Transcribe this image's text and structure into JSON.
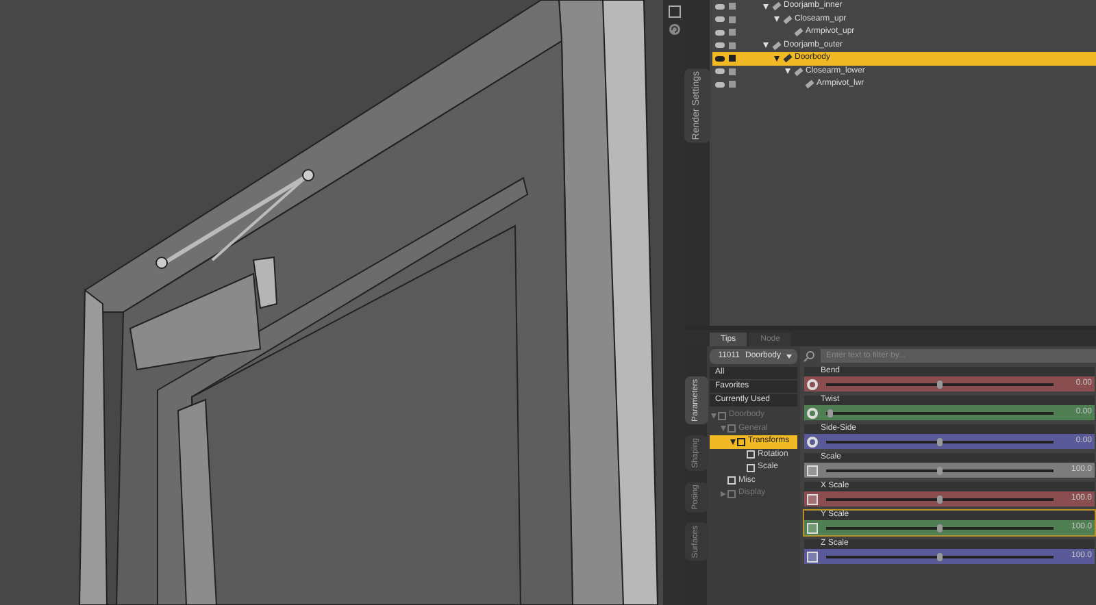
{
  "scene_tree": {
    "tab": "Render Settings",
    "nodes": [
      {
        "label": "Doorjamb_inner",
        "selected": false,
        "expanded": true,
        "children": [
          {
            "label": "Closearm_upr",
            "selected": false,
            "expanded": true,
            "children": [
              {
                "label": "Armpivot_upr",
                "selected": false
              }
            ]
          }
        ]
      },
      {
        "label": "Doorjamb_outer",
        "selected": false,
        "expanded": true,
        "children": [
          {
            "label": "Doorbody",
            "selected": true,
            "expanded": true,
            "children": [
              {
                "label": "Closearm_lower",
                "selected": false,
                "expanded": true,
                "children": [
                  {
                    "label": "Armpivot_lwr",
                    "selected": false
                  }
                ]
              }
            ]
          }
        ]
      }
    ]
  },
  "pane_tabs": [
    {
      "label": "Tips",
      "selected": true
    },
    {
      "label": "Node",
      "selected": false
    }
  ],
  "side_tabs": [
    {
      "label": "Parameters",
      "selected": true
    },
    {
      "label": "Shaping",
      "selected": false
    },
    {
      "label": "Posing",
      "selected": false
    },
    {
      "label": "Surfaces",
      "selected": false
    }
  ],
  "parameters": {
    "node_menu": {
      "prefix": "11011",
      "label": "Doorbody"
    },
    "search": {
      "placeholder": "Enter text to filter by..."
    },
    "categories": [
      {
        "label": "All"
      },
      {
        "label": "Favorites"
      },
      {
        "label": "Currently Used"
      }
    ],
    "groups": [
      {
        "label": "Doorbody",
        "selected": false,
        "disabled": true,
        "expanded": true,
        "children": [
          {
            "label": "General",
            "selected": false,
            "disabled": true,
            "expanded": true,
            "children": [
              {
                "label": "Transforms",
                "selected": true,
                "disabled": false,
                "expanded": true,
                "children": [
                  {
                    "label": "Rotation",
                    "selected": false,
                    "disabled": false
                  },
                  {
                    "label": "Scale",
                    "selected": false,
                    "disabled": false
                  }
                ]
              }
            ]
          },
          {
            "label": "Misc",
            "selected": false,
            "disabled": false
          },
          {
            "label": "Display",
            "selected": false,
            "disabled": true,
            "expanded": false
          }
        ]
      }
    ],
    "sliders": [
      {
        "label": "Bend",
        "kind": "rotate",
        "color": "#8a4e50",
        "level": 0.5,
        "reading": "0.00",
        "selected": false
      },
      {
        "label": "Twist",
        "kind": "rotate",
        "color": "#4f7f52",
        "level": 0.02,
        "reading": "0.00",
        "selected": false
      },
      {
        "label": "Side-Side",
        "kind": "rotate",
        "color": "#5a5a98",
        "level": 0.5,
        "reading": "0.00",
        "selected": false
      },
      {
        "label": "Scale",
        "kind": "scale",
        "color": "#7c7c7c",
        "level": 0.5,
        "reading": "100.0",
        "selected": false
      },
      {
        "label": "X Scale",
        "kind": "scale",
        "color": "#8a4e50",
        "level": 0.5,
        "reading": "100.0",
        "selected": false
      },
      {
        "label": "Y Scale",
        "kind": "scale",
        "color": "#4f7f52",
        "level": 0.5,
        "reading": "100.0",
        "selected": true
      },
      {
        "label": "Z Scale",
        "kind": "scale",
        "color": "#5a5a98",
        "level": 0.5,
        "reading": "100.0",
        "selected": false
      }
    ]
  }
}
